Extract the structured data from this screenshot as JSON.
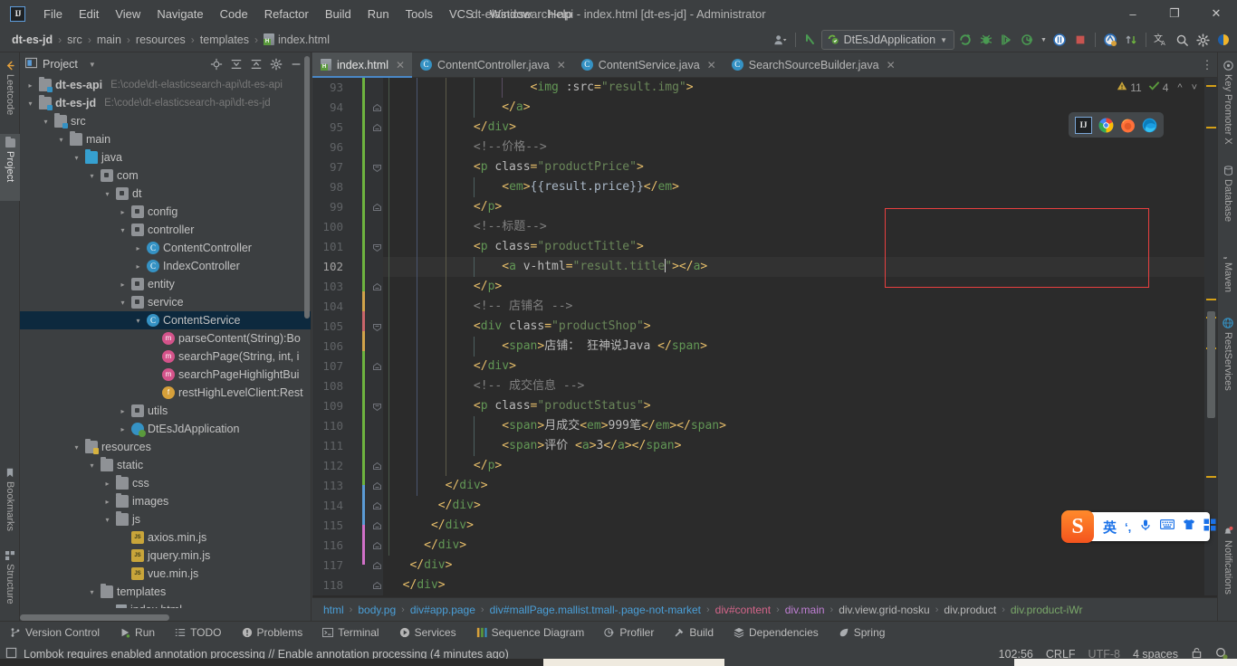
{
  "window": {
    "title": "dt-elasticsearch-api - index.html [dt-es-jd] - Administrator",
    "logo": "intellij-idea-logo",
    "minimize": "–",
    "maximize": "❐",
    "close": "✕"
  },
  "menubar": [
    "File",
    "Edit",
    "View",
    "Navigate",
    "Code",
    "Refactor",
    "Build",
    "Run",
    "Tools",
    "VCS",
    "Window",
    "Help"
  ],
  "navbar": {
    "crumbs": [
      "dt-es-jd",
      "src",
      "main",
      "resources",
      "templates",
      "index.html"
    ],
    "run_config": "DtEsJdApplication",
    "toolbar_icons": [
      "user-avatar-icon",
      "back-arrow-icon",
      "rerun-icon",
      "debug-icon",
      "run-with-coverage-icon",
      "profile-icon",
      "attach-debugger-icon",
      "stop-icon",
      "idea-assistant-icon",
      "update-project-icon",
      "translate-icon",
      "search-everywhere-icon",
      "settings-gear-icon",
      "theme-toggle-icon"
    ]
  },
  "left_strip": [
    {
      "label": "Leetcode",
      "icon": "leetcode-icon",
      "active": false
    },
    {
      "label": "Project",
      "icon": "folder-icon",
      "active": true
    },
    {
      "label": "Bookmarks",
      "icon": "bookmark-icon",
      "active": false
    },
    {
      "label": "Structure",
      "icon": "structure-icon",
      "active": false
    }
  ],
  "right_strip": [
    {
      "label": "Key Promoter X",
      "icon": "key-promoter-icon"
    },
    {
      "label": "Database",
      "icon": "database-icon"
    },
    {
      "label": "Maven",
      "icon": "maven-icon"
    },
    {
      "label": "RestServices",
      "icon": "rest-services-icon"
    },
    {
      "label": "Notifications",
      "icon": "notifications-icon"
    }
  ],
  "project_panel": {
    "title": "Project",
    "header_icons": [
      "locate-icon",
      "expand-all-icon",
      "collapse-all-icon",
      "settings-gear-icon",
      "hide-icon"
    ],
    "tree": [
      {
        "indent": 0,
        "arrow": "›",
        "icon": "module-icon",
        "label": "dt-es-api",
        "path": "E:\\code\\dt-elasticsearch-api\\dt-es-api",
        "bold": true,
        "selected": false
      },
      {
        "indent": 0,
        "arrow": "⌄",
        "icon": "module-icon",
        "label": "dt-es-jd",
        "path": "E:\\code\\dt-elasticsearch-api\\dt-es-jd",
        "bold": true,
        "selected": false
      },
      {
        "indent": 1,
        "arrow": "⌄",
        "icon": "source-folder-icon",
        "label": "src",
        "path": "",
        "bold": false,
        "selected": false
      },
      {
        "indent": 2,
        "arrow": "⌄",
        "icon": "folder-icon",
        "label": "main",
        "path": "",
        "bold": false,
        "selected": false
      },
      {
        "indent": 3,
        "arrow": "⌄",
        "icon": "java-source-folder-icon",
        "label": "java",
        "path": "",
        "bold": false,
        "selected": false
      },
      {
        "indent": 4,
        "arrow": "⌄",
        "icon": "package-icon",
        "label": "com",
        "path": "",
        "bold": false,
        "selected": false
      },
      {
        "indent": 5,
        "arrow": "⌄",
        "icon": "package-icon",
        "label": "dt",
        "path": "",
        "bold": false,
        "selected": false
      },
      {
        "indent": 6,
        "arrow": "›",
        "icon": "package-icon",
        "label": "config",
        "path": "",
        "bold": false,
        "selected": false
      },
      {
        "indent": 6,
        "arrow": "⌄",
        "icon": "package-icon",
        "label": "controller",
        "path": "",
        "bold": false,
        "selected": false
      },
      {
        "indent": 7,
        "arrow": "›",
        "icon": "class-icon",
        "label": "ContentController",
        "path": "",
        "bold": false,
        "selected": false
      },
      {
        "indent": 7,
        "arrow": "›",
        "icon": "class-icon",
        "label": "IndexController",
        "path": "",
        "bold": false,
        "selected": false
      },
      {
        "indent": 6,
        "arrow": "›",
        "icon": "package-icon",
        "label": "entity",
        "path": "",
        "bold": false,
        "selected": false
      },
      {
        "indent": 6,
        "arrow": "⌄",
        "icon": "package-icon",
        "label": "service",
        "path": "",
        "bold": false,
        "selected": false
      },
      {
        "indent": 7,
        "arrow": "⌄",
        "icon": "class-icon",
        "label": "ContentService",
        "path": "",
        "bold": false,
        "selected": true
      },
      {
        "indent": 8,
        "arrow": "",
        "icon": "method-icon",
        "label": "parseContent(String):Bo",
        "path": "",
        "bold": false,
        "selected": false
      },
      {
        "indent": 8,
        "arrow": "",
        "icon": "method-icon",
        "label": "searchPage(String, int, i",
        "path": "",
        "bold": false,
        "selected": false
      },
      {
        "indent": 8,
        "arrow": "",
        "icon": "method-icon",
        "label": "searchPageHighlightBui",
        "path": "",
        "bold": false,
        "selected": false
      },
      {
        "indent": 8,
        "arrow": "",
        "icon": "field-icon",
        "label": "restHighLevelClient:Rest",
        "path": "",
        "bold": false,
        "selected": false
      },
      {
        "indent": 6,
        "arrow": "›",
        "icon": "package-icon",
        "label": "utils",
        "path": "",
        "bold": false,
        "selected": false
      },
      {
        "indent": 6,
        "arrow": "›",
        "icon": "spring-class-icon",
        "label": "DtEsJdApplication",
        "path": "",
        "bold": false,
        "selected": false
      },
      {
        "indent": 3,
        "arrow": "⌄",
        "icon": "resources-folder-icon",
        "label": "resources",
        "path": "",
        "bold": false,
        "selected": false
      },
      {
        "indent": 4,
        "arrow": "⌄",
        "icon": "folder-icon",
        "label": "static",
        "path": "",
        "bold": false,
        "selected": false
      },
      {
        "indent": 5,
        "arrow": "›",
        "icon": "folder-icon",
        "label": "css",
        "path": "",
        "bold": false,
        "selected": false
      },
      {
        "indent": 5,
        "arrow": "›",
        "icon": "folder-icon",
        "label": "images",
        "path": "",
        "bold": false,
        "selected": false
      },
      {
        "indent": 5,
        "arrow": "⌄",
        "icon": "folder-icon",
        "label": "js",
        "path": "",
        "bold": false,
        "selected": false
      },
      {
        "indent": 6,
        "arrow": "",
        "icon": "js-file-icon",
        "label": "axios.min.js",
        "path": "",
        "bold": false,
        "selected": false
      },
      {
        "indent": 6,
        "arrow": "",
        "icon": "js-file-icon",
        "label": "jquery.min.js",
        "path": "",
        "bold": false,
        "selected": false
      },
      {
        "indent": 6,
        "arrow": "",
        "icon": "js-file-icon",
        "label": "vue.min.js",
        "path": "",
        "bold": false,
        "selected": false
      },
      {
        "indent": 4,
        "arrow": "⌄",
        "icon": "folder-icon",
        "label": "templates",
        "path": "",
        "bold": false,
        "selected": false
      },
      {
        "indent": 5,
        "arrow": "",
        "icon": "html-file-icon",
        "label": "index.html",
        "path": "",
        "bold": false,
        "selected": false
      }
    ]
  },
  "editor": {
    "tabs": [
      {
        "label": "index.html",
        "icon": "html-file-icon",
        "active": true
      },
      {
        "label": "ContentController.java",
        "icon": "java-class-icon",
        "active": false
      },
      {
        "label": "ContentService.java",
        "icon": "java-class-icon",
        "active": false
      },
      {
        "label": "SearchSourceBuilder.java",
        "icon": "java-class-icon",
        "active": false
      }
    ],
    "inspections": {
      "warning_count": "11",
      "ok_count": "4",
      "warning_icon": "warning-triangle-icon",
      "ok_icon": "checkmark-icon",
      "prev_icon": "chevron-up-icon",
      "next_icon": "chevron-down-icon"
    },
    "first_line": 93,
    "caret_line": 102,
    "lines": [
      {
        "n": 93,
        "text": "                    <img :src=\"result.img\">"
      },
      {
        "n": 94,
        "text": "                </a>"
      },
      {
        "n": 95,
        "text": "            </div>"
      },
      {
        "n": 96,
        "text": "            <!--价格-->"
      },
      {
        "n": 97,
        "text": "            <p class=\"productPrice\">"
      },
      {
        "n": 98,
        "text": "                <em>{{result.price}}</em>"
      },
      {
        "n": 99,
        "text": "            </p>"
      },
      {
        "n": 100,
        "text": "            <!--标题-->"
      },
      {
        "n": 101,
        "text": "            <p class=\"productTitle\">"
      },
      {
        "n": 102,
        "text": "                <a v-html=\"result.title\"></a>"
      },
      {
        "n": 103,
        "text": "            </p>"
      },
      {
        "n": 104,
        "text": "            <!-- 店铺名 -->"
      },
      {
        "n": 105,
        "text": "            <div class=\"productShop\">"
      },
      {
        "n": 106,
        "text": "                <span>店铺： 狂神说Java </span>"
      },
      {
        "n": 107,
        "text": "            </div>"
      },
      {
        "n": 108,
        "text": "            <!-- 成交信息 -->"
      },
      {
        "n": 109,
        "text": "            <p class=\"productStatus\">"
      },
      {
        "n": 110,
        "text": "                <span>月成交<em>999笔</em></span>"
      },
      {
        "n": 111,
        "text": "                <span>评价 <a>3</a></span>"
      },
      {
        "n": 112,
        "text": "            </p>"
      },
      {
        "n": 113,
        "text": "        </div>"
      },
      {
        "n": 114,
        "text": "       </div>"
      },
      {
        "n": 115,
        "text": "      </div>"
      },
      {
        "n": 116,
        "text": "     </div>"
      },
      {
        "n": 117,
        "text": "   </div>"
      },
      {
        "n": 118,
        "text": "  </div>"
      }
    ],
    "breadcrumbs": [
      {
        "label": "html",
        "color": "#4a9fd8"
      },
      {
        "label": "body.pg",
        "color": "#4a9fd8"
      },
      {
        "label": "div#app.page",
        "color": "#4a9fd8"
      },
      {
        "label": "div#mallPage.mallist.tmall-.page-not-market",
        "color": "#4a9fd8"
      },
      {
        "label": "div#content",
        "color": "#d4658a"
      },
      {
        "label": "div.main",
        "color": "#c07fd4"
      },
      {
        "label": "div.view.grid-nosku",
        "color": "#b8b8b8"
      },
      {
        "label": "div.product",
        "color": "#b8b8b8"
      },
      {
        "label": "div.product-iWr",
        "color": "#7aa86a"
      }
    ]
  },
  "bottom_bar": [
    {
      "label": "Version Control",
      "icon": "branch-icon"
    },
    {
      "label": "Run",
      "icon": "run-icon"
    },
    {
      "label": "TODO",
      "icon": "todo-icon"
    },
    {
      "label": "Problems",
      "icon": "problems-icon"
    },
    {
      "label": "Terminal",
      "icon": "terminal-icon"
    },
    {
      "label": "Services",
      "icon": "services-icon"
    },
    {
      "label": "Sequence Diagram",
      "icon": "sequence-diagram-icon"
    },
    {
      "label": "Profiler",
      "icon": "profiler-icon"
    },
    {
      "label": "Build",
      "icon": "build-hammer-icon"
    },
    {
      "label": "Dependencies",
      "icon": "dependencies-icon"
    },
    {
      "label": "Spring",
      "icon": "spring-leaf-icon"
    }
  ],
  "statusbar": {
    "message": "Lombok requires enabled annotation processing // Enable annotation processing (4 minutes ago)",
    "message_icon": "event-log-icon",
    "caret_position": "102:56",
    "line_separator": "CRLF",
    "encoding": "UTF-8",
    "indent": "4 spaces",
    "lock_icon": "read-write-lock-icon",
    "inspection_icon": "inspection-profile-icon"
  },
  "overlays": {
    "browser_bar": {
      "items": [
        "intellij-preview-icon",
        "chrome-icon",
        "firefox-icon",
        "edge-icon"
      ]
    },
    "ime_bar": {
      "logo": "S",
      "mode": "英",
      "items": [
        "sogou-logo-icon",
        "lang-mode-icon",
        "punctuation-icon",
        "microphone-icon",
        "keyboard-icon",
        "skin-icon",
        "toolbox-icon"
      ]
    }
  },
  "colors": {
    "accent": "#4a88c7",
    "panel_bg": "#3c3f41",
    "editor_bg": "#2b2b2b",
    "selection": "#0d293e",
    "highlight_box": "#e84040"
  }
}
